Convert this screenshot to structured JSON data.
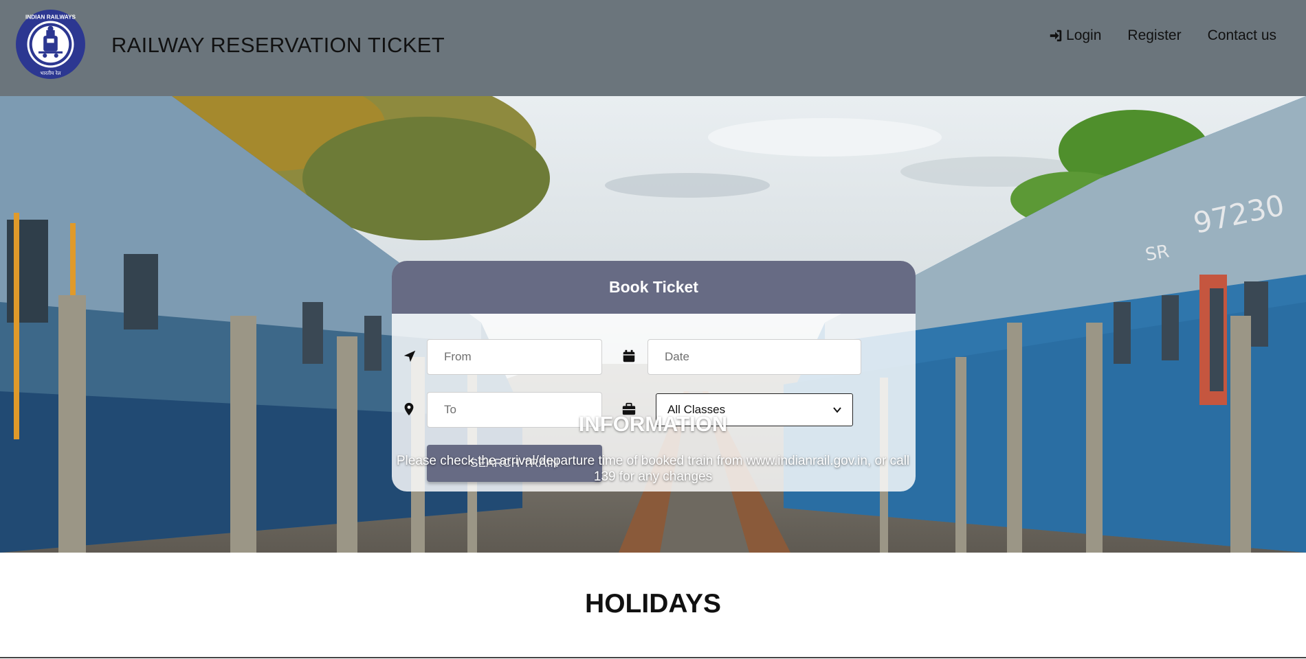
{
  "header": {
    "brand": "RAILWAY RESERVATION TICKET",
    "logo_text_top": "INDIAN RAILWAYS",
    "logo_text_hindi": "भारतीय रेल",
    "nav": {
      "login": "Login",
      "register": "Register",
      "contact": "Contact us"
    }
  },
  "booking": {
    "title": "Book Ticket",
    "from_placeholder": "From",
    "to_placeholder": "To",
    "date_placeholder": "Date",
    "class_selected": "All Classes",
    "search_label": "SEARCH TRAIN",
    "icons": {
      "from": "navigation-arrow-icon",
      "to": "map-pin-icon",
      "date": "calendar-icon",
      "class": "briefcase-icon"
    }
  },
  "info": {
    "title": "INFORMATION",
    "text": "Please check the arrival/departure time of booked train from www.indianrail.gov.in, or call 139 for any changes"
  },
  "sections": {
    "holidays": "HOLIDAYS"
  },
  "hero_coach_numbers": {
    "right": "97230",
    "right_code": "SR"
  },
  "colors": {
    "header_bg": "#6b757c",
    "card_header": "#676b84",
    "button": "#676b84"
  }
}
